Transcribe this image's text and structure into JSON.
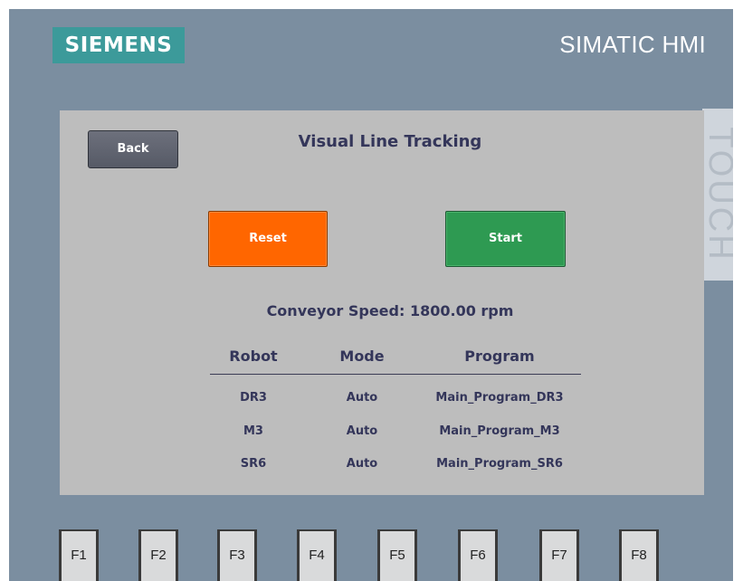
{
  "header": {
    "brand": "SIEMENS",
    "product": "SIMATIC HMI",
    "side_label": "TOUCH"
  },
  "screen": {
    "back_label": "Back",
    "title": "Visual Line Tracking",
    "reset_label": "Reset",
    "start_label": "Start",
    "speed_text": "Conveyor Speed: 1800.00 rpm"
  },
  "table": {
    "headers": [
      "Robot",
      "Mode",
      "Program"
    ],
    "rows": [
      [
        "DR3",
        "Auto",
        "Main_Program_DR3"
      ],
      [
        "M3",
        "Auto",
        "Main_Program_M3"
      ],
      [
        "SR6",
        "Auto",
        "Main_Program_SR6"
      ]
    ]
  },
  "function_keys": [
    "F1",
    "F2",
    "F3",
    "F4",
    "F5",
    "F6",
    "F7",
    "F8"
  ],
  "colors": {
    "bezel": "#7b8ea0",
    "brand": "#3c9a9a",
    "reset": "#ff6600",
    "start": "#2e9a52",
    "text": "#34365a"
  }
}
